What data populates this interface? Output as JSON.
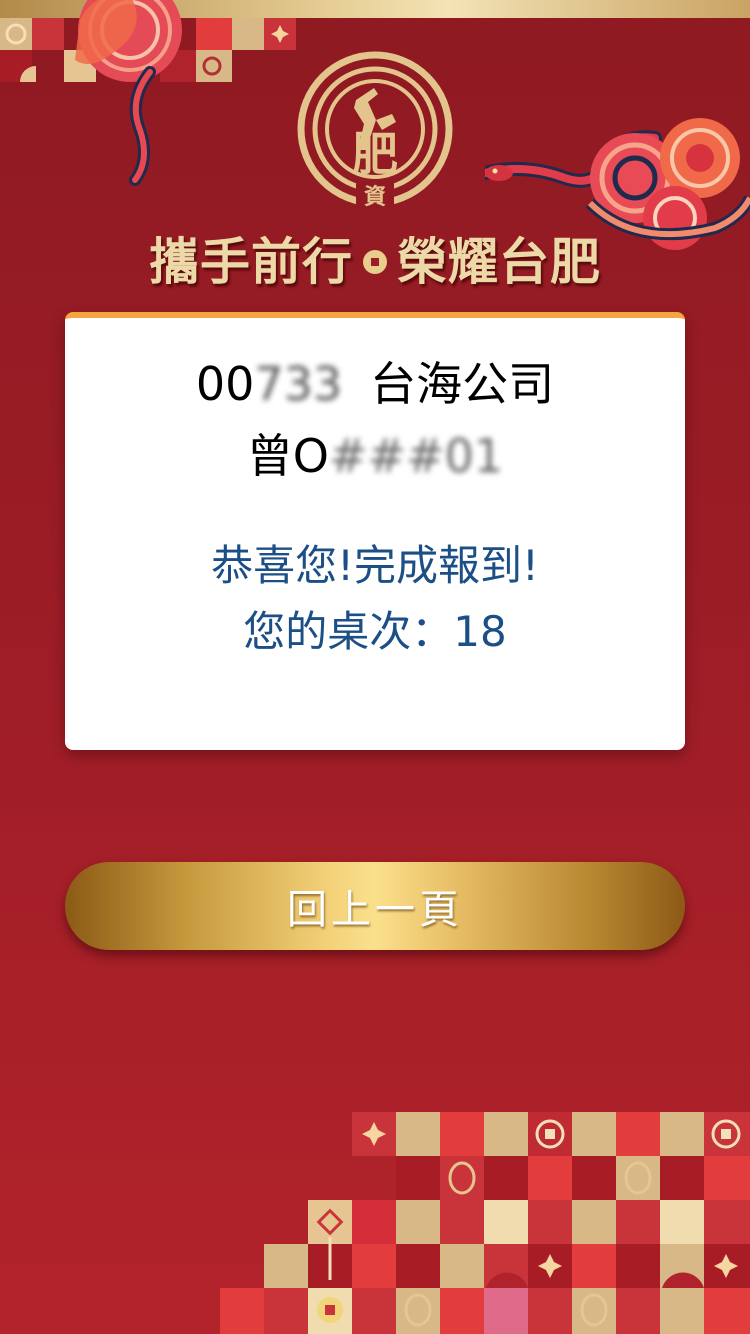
{
  "slogan": {
    "left": "攜手前行",
    "right": "榮耀台肥"
  },
  "logo": {
    "character": "肥",
    "sub_character": "資"
  },
  "card": {
    "code_prefix": "00",
    "code_hidden": "733",
    "company": "台海公司",
    "name_prefix": "曾O",
    "name_hidden": "###01",
    "success_message": "恭喜您!完成報到!",
    "table_label": "您的桌次：",
    "table_number": "18"
  },
  "back_button": {
    "label": "回上一頁"
  },
  "colors": {
    "background": "#9a1c25",
    "gold": "#edd9a8",
    "card_accent": "#f2a541",
    "message_blue": "#1b4f86"
  }
}
